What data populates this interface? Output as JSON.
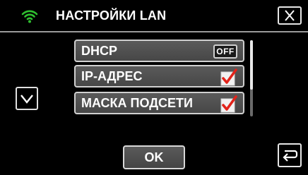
{
  "header": {
    "title": "НАСТРОЙКИ LAN",
    "status_icon": "wifi-icon",
    "close_icon": "close-icon"
  },
  "menu": {
    "items": [
      {
        "label": "DHCP",
        "control": "toggle",
        "value": "OFF"
      },
      {
        "label": "IP-АДРЕС",
        "control": "checkbox",
        "checked": true
      },
      {
        "label": "МАСКА ПОДСЕТИ",
        "control": "checkbox",
        "checked": true
      }
    ]
  },
  "navigation": {
    "down_icon": "chevron-down-icon",
    "back_icon": "back-arrow-icon"
  },
  "footer": {
    "ok_label": "OK"
  },
  "colors": {
    "accent_green": "#2fbf2f",
    "check_red": "#e2231a",
    "background": "#000000",
    "row_fill": "#505050"
  }
}
